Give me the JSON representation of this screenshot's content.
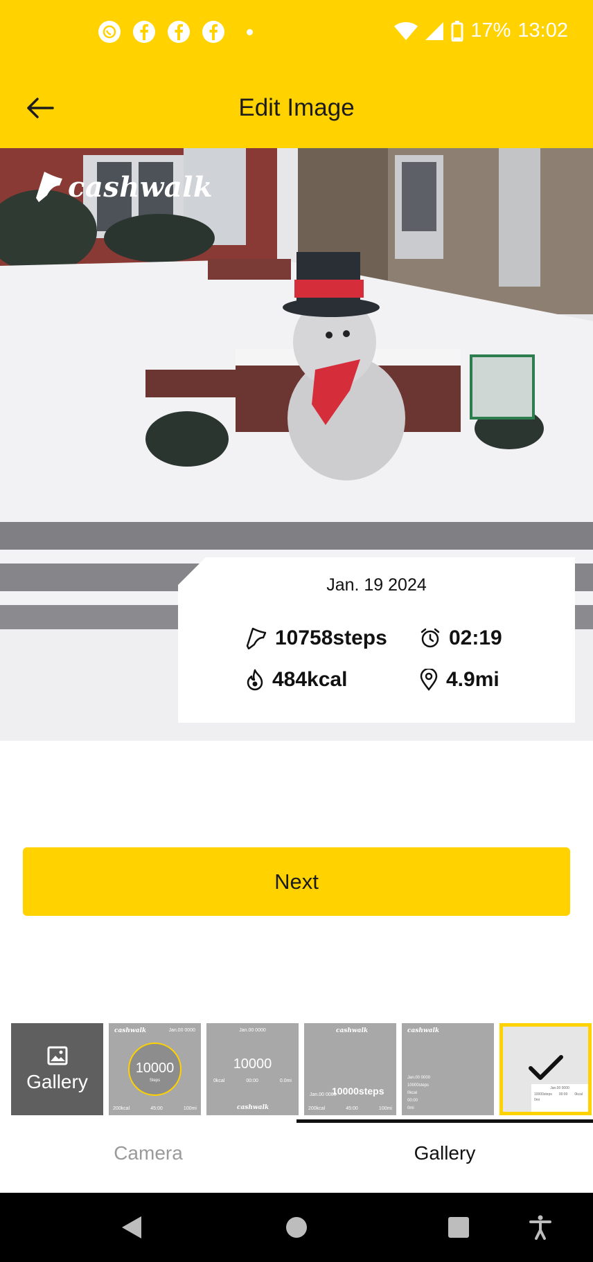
{
  "status_bar": {
    "left_icons": [
      "whatsapp-icon",
      "facebook-icon",
      "facebook-icon",
      "facebook-icon",
      "dot-icon"
    ],
    "battery": "17%",
    "time": "13:02"
  },
  "app_bar": {
    "title": "Edit Image",
    "back_icon": "arrow-left-icon"
  },
  "photo": {
    "brand": "cashwalk"
  },
  "stats_card": {
    "date": "Jan. 19 2024",
    "steps": "10758steps",
    "time": "02:19",
    "calories": "484kcal",
    "distance": "4.9mi"
  },
  "next_button": {
    "label": "Next"
  },
  "templates": {
    "gallery_label": "Gallery",
    "thumb1": {
      "logo": "cashwalk",
      "date": "Jan.00 0000",
      "number": "10000",
      "sub": "Steps",
      "row": [
        "200kcal",
        "45:00",
        "100mi"
      ]
    },
    "thumb2": {
      "date": "Jan.00 0000",
      "number": "10000",
      "row": [
        "0kcal",
        "00:00",
        "0.0mi"
      ],
      "logo": "cashwalk"
    },
    "thumb3": {
      "logo": "cashwalk",
      "date": "Jan.00 0000",
      "steps": "10000steps",
      "row": [
        "200kcal",
        "45:00",
        "100mi"
      ]
    },
    "thumb4": {
      "logo": "cashwalk",
      "lines": [
        "Jan.00 0000",
        "10000steps",
        "0kcal",
        "00:00",
        "0mi"
      ]
    },
    "thumb5": {
      "date": "Jan.00 0000",
      "lines": [
        "10000steps",
        "00:00",
        "0kcal",
        "0mi"
      ]
    }
  },
  "tabs": [
    {
      "label": "Camera",
      "active": false
    },
    {
      "label": "Gallery",
      "active": true
    }
  ],
  "colors": {
    "accent": "#ffd200",
    "nav_bar": "#000000",
    "gallery_tile": "#5f5f5f"
  }
}
